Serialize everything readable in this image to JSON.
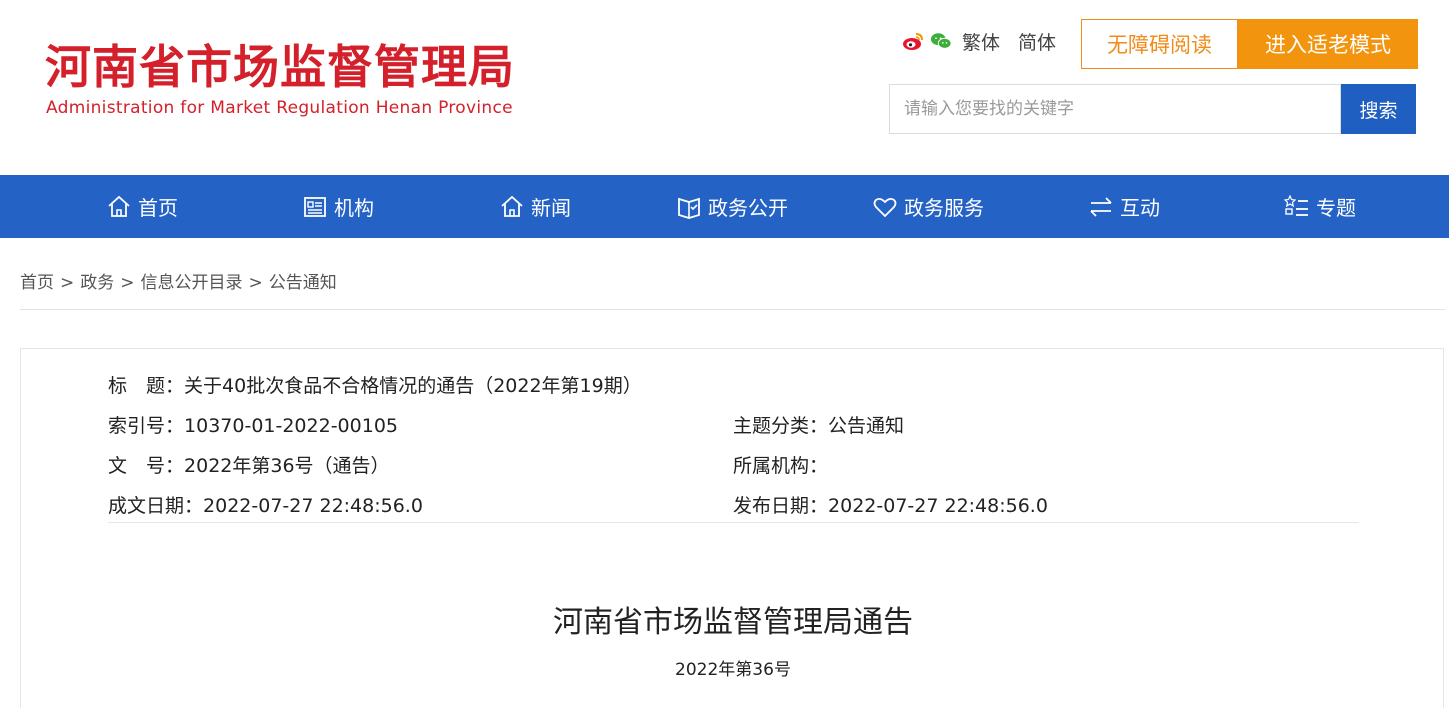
{
  "header": {
    "logo_cn": "河南省市场监督管理局",
    "logo_en": "Administration for Market Regulation Henan Province",
    "traditional_label": "繁体",
    "simplified_label": "简体",
    "accessibility_label": "无障碍阅读",
    "elder_mode_label": "进入适老模式",
    "search_placeholder": "请输入您要找的关键字",
    "search_button": "搜索"
  },
  "nav": {
    "items": [
      {
        "label": "首页",
        "icon": "home-icon"
      },
      {
        "label": "机构",
        "icon": "document-list-icon"
      },
      {
        "label": "新闻",
        "icon": "home-icon"
      },
      {
        "label": "政务公开",
        "icon": "open-book-icon"
      },
      {
        "label": "政务服务",
        "icon": "heart-icon"
      },
      {
        "label": "互动",
        "icon": "swap-arrows-icon"
      },
      {
        "label": "专题",
        "icon": "star-list-icon"
      }
    ]
  },
  "breadcrumb": {
    "items": [
      "首页",
      "政务",
      "信息公开目录",
      "公告通知"
    ],
    "separator": ">"
  },
  "meta": {
    "title_label": "标　题：",
    "title_value": "关于40批次食品不合格情况的通告（2022年第19期）",
    "index_label": "索引号：",
    "index_value": "10370-01-2022-00105",
    "category_label": "主题分类：",
    "category_value": "公告通知",
    "doc_no_label": "文　号：",
    "doc_no_value": "2022年第36号（通告）",
    "org_label": "所属机构：",
    "org_value": "",
    "created_label": "成文日期：",
    "created_value": "2022-07-27 22:48:56.0",
    "published_label": "发布日期：",
    "published_value": "2022-07-27 22:48:56.0"
  },
  "document": {
    "heading": "河南省市场监督管理局通告",
    "number": "2022年第36号"
  },
  "colors": {
    "brand_red": "#d4202a",
    "nav_blue": "#2462c6",
    "search_blue": "#1f5fc1",
    "accent_orange": "#f2940e"
  }
}
